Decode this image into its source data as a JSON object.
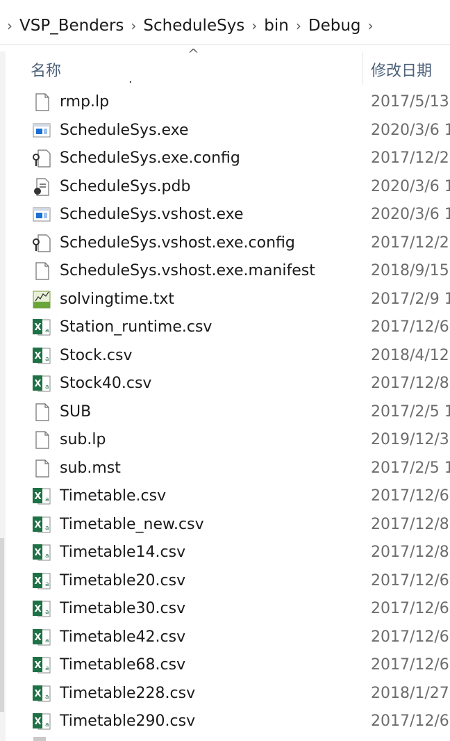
{
  "breadcrumb": {
    "items": [
      "VSP_Benders",
      "ScheduleSys",
      "bin",
      "Debug"
    ]
  },
  "columns": {
    "name": "名称",
    "date_modified": "修改日期"
  },
  "files": [
    {
      "name": "rmp.lp",
      "date": "2017/5/13 ",
      "icon": "blank-file-icon"
    },
    {
      "name": "ScheduleSys.exe",
      "date": "2020/3/6 1",
      "icon": "exe-file-icon"
    },
    {
      "name": "ScheduleSys.exe.config",
      "date": "2017/12/2",
      "icon": "config-file-icon"
    },
    {
      "name": "ScheduleSys.pdb",
      "date": "2020/3/6 1",
      "icon": "pdb-file-icon"
    },
    {
      "name": "ScheduleSys.vshost.exe",
      "date": "2020/3/6 1",
      "icon": "exe-file-icon"
    },
    {
      "name": "ScheduleSys.vshost.exe.config",
      "date": "2017/12/2",
      "icon": "config-file-icon"
    },
    {
      "name": "ScheduleSys.vshost.exe.manifest",
      "date": "2018/9/15",
      "icon": "blank-file-icon"
    },
    {
      "name": "solvingtime.txt",
      "date": "2017/2/9 1",
      "icon": "text-file-icon"
    },
    {
      "name": "Station_runtime.csv",
      "date": "2017/12/6",
      "icon": "excel-file-icon"
    },
    {
      "name": "Stock.csv",
      "date": "2018/4/12",
      "icon": "excel-file-icon"
    },
    {
      "name": "Stock40.csv",
      "date": "2017/12/8",
      "icon": "excel-file-icon"
    },
    {
      "name": "SUB",
      "date": "2017/2/5 1",
      "icon": "blank-file-icon"
    },
    {
      "name": "sub.lp",
      "date": "2019/12/3",
      "icon": "blank-file-icon"
    },
    {
      "name": "sub.mst",
      "date": "2017/2/5 1",
      "icon": "blank-file-icon"
    },
    {
      "name": "Timetable.csv",
      "date": "2017/12/6",
      "icon": "excel-file-icon"
    },
    {
      "name": "Timetable_new.csv",
      "date": "2017/12/8",
      "icon": "excel-file-icon"
    },
    {
      "name": "Timetable14.csv",
      "date": "2017/12/8",
      "icon": "excel-file-icon"
    },
    {
      "name": "Timetable20.csv",
      "date": "2017/12/6",
      "icon": "excel-file-icon"
    },
    {
      "name": "Timetable30.csv",
      "date": "2017/12/6",
      "icon": "excel-file-icon"
    },
    {
      "name": "Timetable42.csv",
      "date": "2017/12/6",
      "icon": "excel-file-icon"
    },
    {
      "name": "Timetable68.csv",
      "date": "2017/12/6",
      "icon": "excel-file-icon"
    },
    {
      "name": "Timetable228.csv",
      "date": "2018/1/27",
      "icon": "excel-file-icon"
    },
    {
      "name": "Timetable290.csv",
      "date": "2017/12/6",
      "icon": "excel-file-icon"
    }
  ],
  "colors": {
    "header_text": "#4c607a",
    "excel_green": "#1e7145",
    "exe_blue": "#1a6fd4"
  }
}
